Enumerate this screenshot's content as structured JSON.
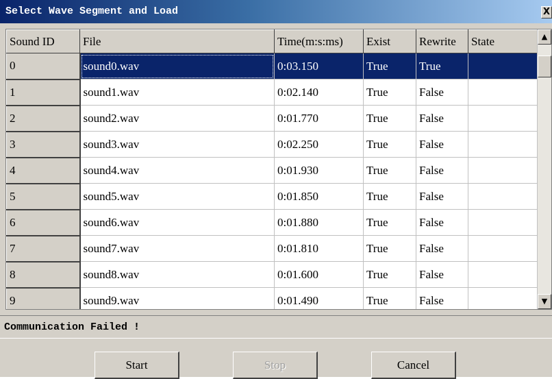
{
  "window": {
    "title": "Select Wave Segment and Load",
    "close_glyph": "X"
  },
  "grid": {
    "columns": [
      "Sound ID",
      "File",
      "Time(m:s:ms)",
      "Exist",
      "Rewrite",
      "State"
    ],
    "rows": [
      {
        "id": "0",
        "file": "sound0.wav",
        "time": "0:03.150",
        "exist": "True",
        "rewrite": "True",
        "state": "",
        "selected": true
      },
      {
        "id": "1",
        "file": "sound1.wav",
        "time": "0:02.140",
        "exist": "True",
        "rewrite": "False",
        "state": ""
      },
      {
        "id": "2",
        "file": "sound2.wav",
        "time": "0:01.770",
        "exist": "True",
        "rewrite": "False",
        "state": ""
      },
      {
        "id": "3",
        "file": "sound3.wav",
        "time": "0:02.250",
        "exist": "True",
        "rewrite": "False",
        "state": ""
      },
      {
        "id": "4",
        "file": "sound4.wav",
        "time": "0:01.930",
        "exist": "True",
        "rewrite": "False",
        "state": ""
      },
      {
        "id": "5",
        "file": "sound5.wav",
        "time": "0:01.850",
        "exist": "True",
        "rewrite": "False",
        "state": ""
      },
      {
        "id": "6",
        "file": "sound6.wav",
        "time": "0:01.880",
        "exist": "True",
        "rewrite": "False",
        "state": ""
      },
      {
        "id": "7",
        "file": "sound7.wav",
        "time": "0:01.810",
        "exist": "True",
        "rewrite": "False",
        "state": ""
      },
      {
        "id": "8",
        "file": "sound8.wav",
        "time": "0:01.600",
        "exist": "True",
        "rewrite": "False",
        "state": ""
      },
      {
        "id": "9",
        "file": "sound9.wav",
        "time": "0:01.490",
        "exist": "True",
        "rewrite": "False",
        "state": ""
      }
    ]
  },
  "scrollbar": {
    "up_icon": "up-arrow-icon",
    "down_icon": "down-arrow-icon",
    "up_glyph": "▲",
    "down_glyph": "▼"
  },
  "status": {
    "text": "Communication Failed !"
  },
  "buttons": {
    "start": "Start",
    "stop": "Stop",
    "cancel": "Cancel",
    "stop_disabled": true
  },
  "colors": {
    "title_bar": "#0a246a",
    "selection": "#0a246a",
    "face": "#d4d0c8"
  }
}
